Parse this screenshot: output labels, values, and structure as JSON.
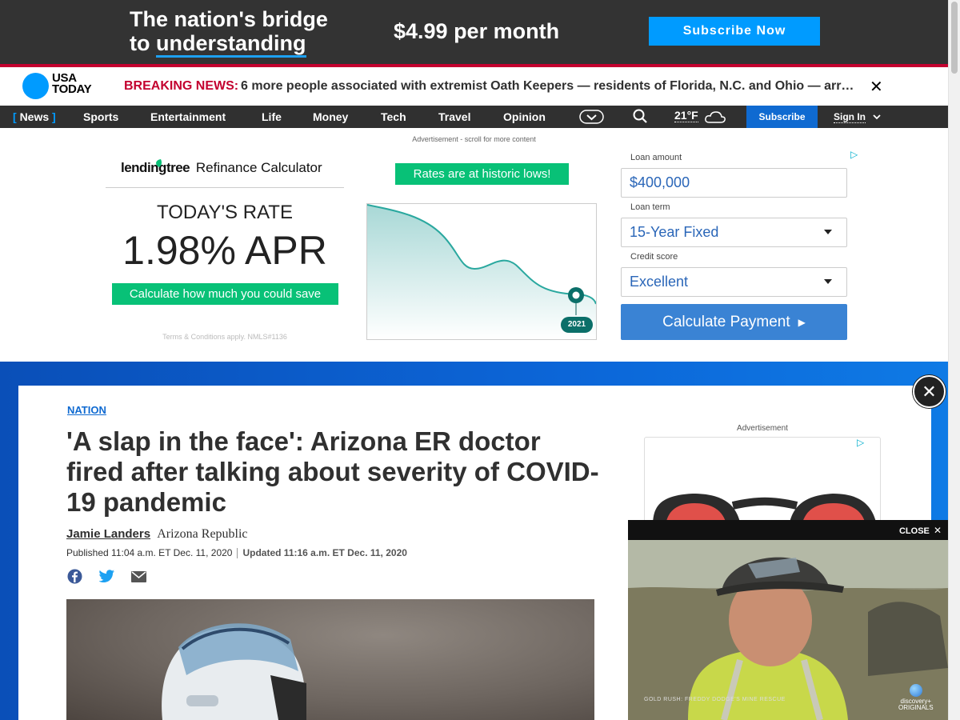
{
  "promo": {
    "tagline_line1": "The nation's bridge",
    "tagline_line2_prefix": "to ",
    "tagline_line2_underlined": "understanding",
    "price": "$4.99 per month",
    "cta": "Subscribe Now"
  },
  "brand": {
    "logo_line1": "USA",
    "logo_line2": "TODAY",
    "accent": "#009bff"
  },
  "breaking": {
    "label": "BREAKING NEWS:",
    "text": "6 more people associated with extremist Oath Keepers — residents of Florida, N.C. and Ohio — arrested",
    "close_icon": "close-icon"
  },
  "nav": {
    "items": [
      {
        "label": "News",
        "bracket_open": "[",
        "bracket_close": "]",
        "active": true
      },
      {
        "label": "Sports"
      },
      {
        "label": "Entertainment"
      },
      {
        "label": "Life"
      },
      {
        "label": "Money"
      },
      {
        "label": "Tech"
      },
      {
        "label": "Travel"
      },
      {
        "label": "Opinion"
      }
    ],
    "more_icon": "chevron-down-circle-icon",
    "search_icon": "search-icon",
    "weather": "21°F",
    "weather_icon": "cloud-icon",
    "subscribe": "Subscribe",
    "signin": "Sign In"
  },
  "ad": {
    "note": "Advertisement - scroll for more content",
    "lender_brand": "lendingtree",
    "calculator_title": "Refinance Calculator",
    "rate_label": "TODAY'S RATE",
    "rate_value": "1.98% APR",
    "calc_cta": "Calculate how much you could save",
    "terms": "Terms & Conditions apply. NMLS#1136",
    "chart_badge": "Rates are at historic lows!",
    "chart_point_label": "2021",
    "form": {
      "loan_amount_label": "Loan amount",
      "loan_amount_value": "$400,000",
      "loan_term_label": "Loan term",
      "loan_term_value": "15-Year Fixed",
      "credit_label": "Credit score",
      "credit_value": "Excellent",
      "submit": "Calculate Payment"
    }
  },
  "article": {
    "section": "NATION",
    "headline": "'A slap in the face': Arizona ER doctor fired after talking about severity of COVID-19 pandemic",
    "author": "Jamie Landers",
    "publication": "Arizona Republic",
    "published": "Published 11:04 a.m. ET Dec. 11, 2020",
    "updated": "Updated 11:16 a.m. ET Dec. 11, 2020",
    "share": [
      "facebook-icon",
      "twitter-icon",
      "email-icon"
    ]
  },
  "sidebar": {
    "ad_label": "Advertisement"
  },
  "video": {
    "close": "CLOSE",
    "caption": "GOLD RUSH: FREDDY DODGE'S MINE RESCUE",
    "brand_line1": "discovery+",
    "brand_line2": "ORIGINALS"
  }
}
